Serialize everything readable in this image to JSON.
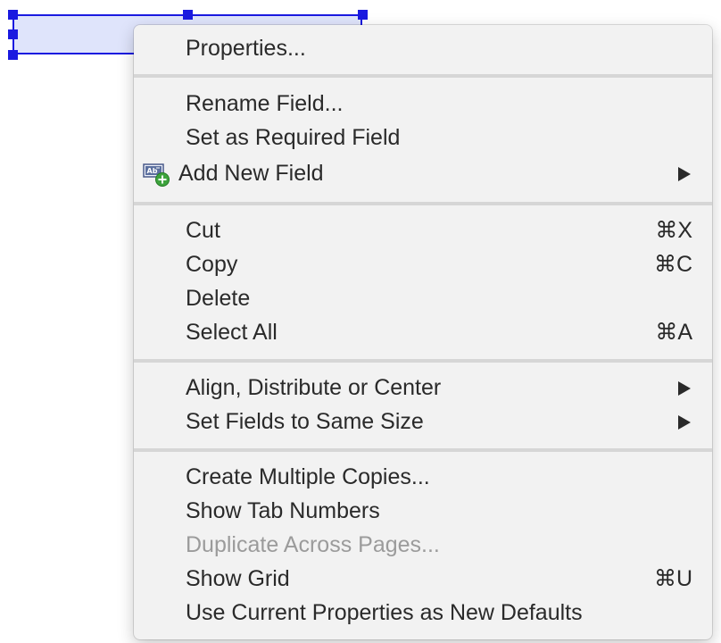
{
  "field": {
    "border_color": "#1a1ae0",
    "fill_color": "#dfe4fb"
  },
  "menu": {
    "items": [
      {
        "label": "Properties..."
      },
      {
        "label": "Rename Field..."
      },
      {
        "label": "Set as Required Field"
      },
      {
        "label": "Add New Field",
        "icon": "add-field-icon",
        "submenu": true
      },
      {
        "label": "Cut",
        "shortcut": "⌘X"
      },
      {
        "label": "Copy",
        "shortcut": "⌘C"
      },
      {
        "label": "Delete"
      },
      {
        "label": "Select All",
        "shortcut": "⌘A"
      },
      {
        "label": "Align, Distribute or Center",
        "submenu": true
      },
      {
        "label": "Set Fields to Same Size",
        "submenu": true
      },
      {
        "label": "Create Multiple Copies..."
      },
      {
        "label": "Show Tab Numbers"
      },
      {
        "label": "Duplicate Across Pages...",
        "disabled": true
      },
      {
        "label": "Show Grid",
        "shortcut": "⌘U"
      },
      {
        "label": "Use Current Properties as New Defaults"
      }
    ]
  }
}
